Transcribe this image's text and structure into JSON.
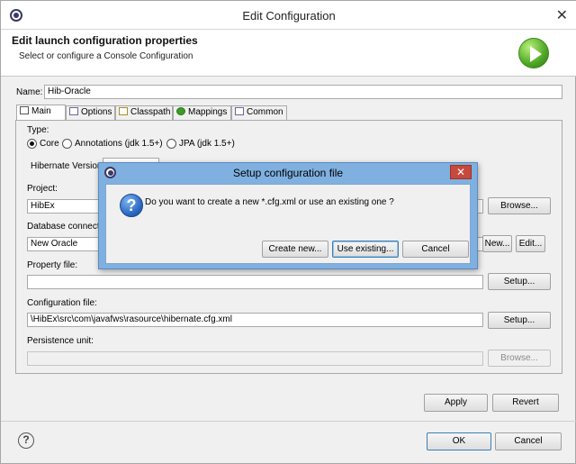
{
  "window": {
    "title": "Edit Configuration",
    "close": "✕"
  },
  "banner": {
    "heading": "Edit launch configuration properties",
    "subtitle": "Select or configure a Console Configuration"
  },
  "name": {
    "label": "Name:",
    "value": "Hib-Oracle"
  },
  "tabs": [
    {
      "label": "Main"
    },
    {
      "label": "Options"
    },
    {
      "label": "Classpath"
    },
    {
      "label": "Mappings"
    },
    {
      "label": "Common"
    }
  ],
  "type_group": {
    "label": "Type:",
    "options": [
      {
        "label": "Core",
        "selected": true
      },
      {
        "label": "Annotations (jdk 1.5+)",
        "selected": false
      },
      {
        "label": "JPA (jdk 1.5+)",
        "selected": false
      }
    ],
    "hibernate_version_label": "Hibernate Version:"
  },
  "project": {
    "label": "Project:",
    "value": "HibEx",
    "browse": "Browse..."
  },
  "db_connection": {
    "label": "Database connecti",
    "value": "New Oracle",
    "new_btn": "New...",
    "edit_btn": "Edit..."
  },
  "property_file": {
    "label": "Property file:",
    "value": "",
    "setup": "Setup..."
  },
  "config_file": {
    "label": "Configuration file:",
    "value": "\\HibEx\\src\\com\\javafws\\rasource\\hibernate.cfg.xml",
    "setup": "Setup..."
  },
  "persistence": {
    "label": "Persistence unit:",
    "value": "",
    "browse": "Browse..."
  },
  "footer": {
    "apply": "Apply",
    "revert": "Revert",
    "ok": "OK",
    "cancel": "Cancel",
    "help": "?"
  },
  "dialog": {
    "title": "Setup configuration file",
    "close": "✕",
    "message": "Do you want to create a new *.cfg.xml or use an existing one ?",
    "create_new": "Create new...",
    "use_existing": "Use existing...",
    "cancel": "Cancel",
    "icon": "?"
  }
}
